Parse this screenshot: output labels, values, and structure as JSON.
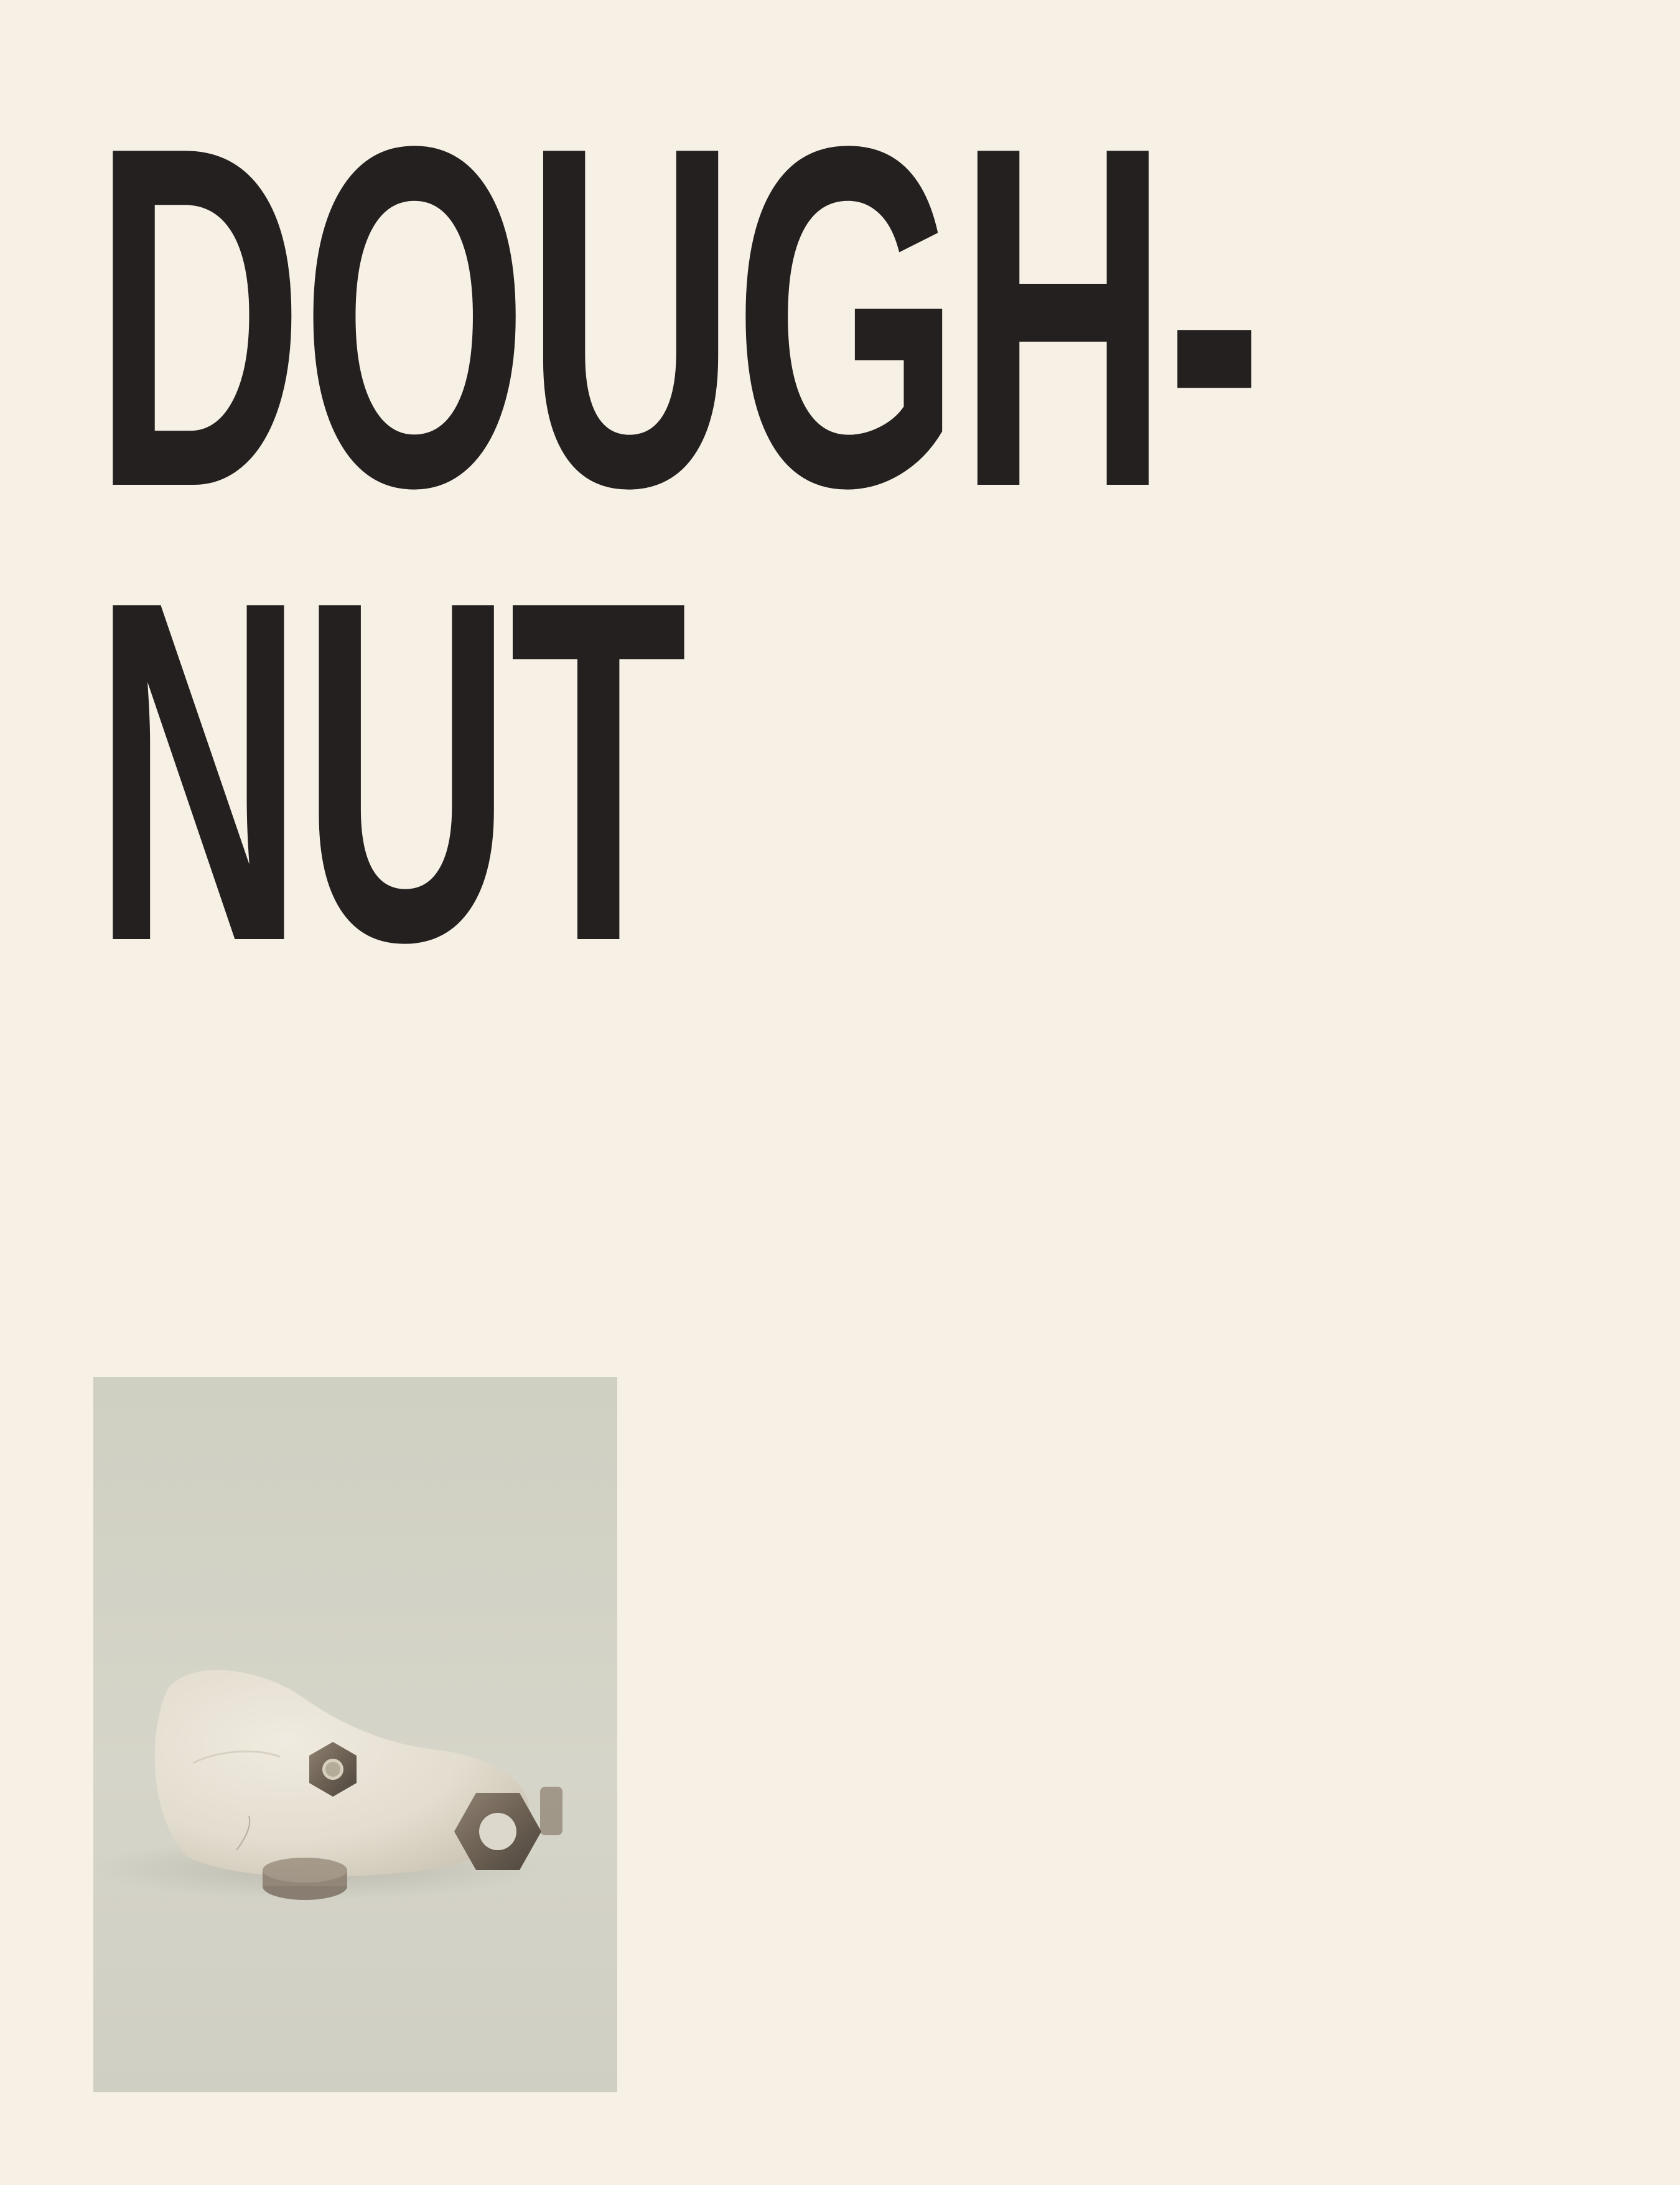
{
  "headline": {
    "line1": "DOUGH-",
    "line2": "NUT"
  },
  "photo": {
    "subject": "clay-dough-with-hex-nuts"
  },
  "colors": {
    "background": "#f6f0e5",
    "headline_text": "#242020",
    "photo_backdrop": "#d4d3c6",
    "dough": "#e9e3d6",
    "nut_metal": "#7a6c5f"
  }
}
